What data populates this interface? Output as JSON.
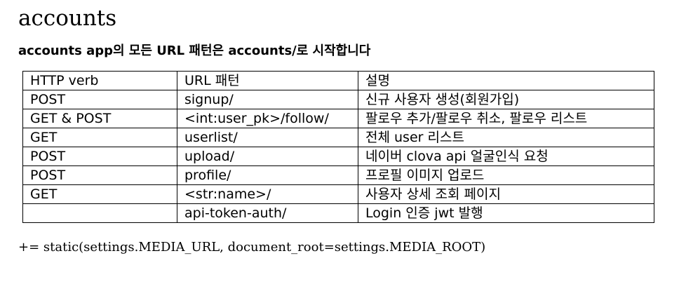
{
  "title": "accounts",
  "subtitle": "accounts app의 모든 URL 패턴은 accounts/로 시작합니다",
  "table": {
    "headers": [
      "HTTP verb",
      "URL 패턴",
      "설명"
    ],
    "rows": [
      [
        "POST",
        "signup/",
        "신규 사용자 생성(회원가입)"
      ],
      [
        "GET & POST",
        "<int:user_pk>/follow/",
        "팔로우 추가/팔로우 취소, 팔로우 리스트"
      ],
      [
        "GET",
        "userlist/",
        "전체 user 리스트"
      ],
      [
        "POST",
        "upload/",
        "네이버 clova api 얼굴인식 요청"
      ],
      [
        "POST",
        "profile/",
        "프로필 이미지 업로드"
      ],
      [
        "GET",
        "<str:name>/",
        "사용자 상세 조회 페이지"
      ],
      [
        "",
        "api-token-auth/",
        "Login 인증 jwt 발행"
      ]
    ]
  },
  "footer": "+= static(settings.MEDIA_URL, document_root=settings.MEDIA_ROOT)"
}
